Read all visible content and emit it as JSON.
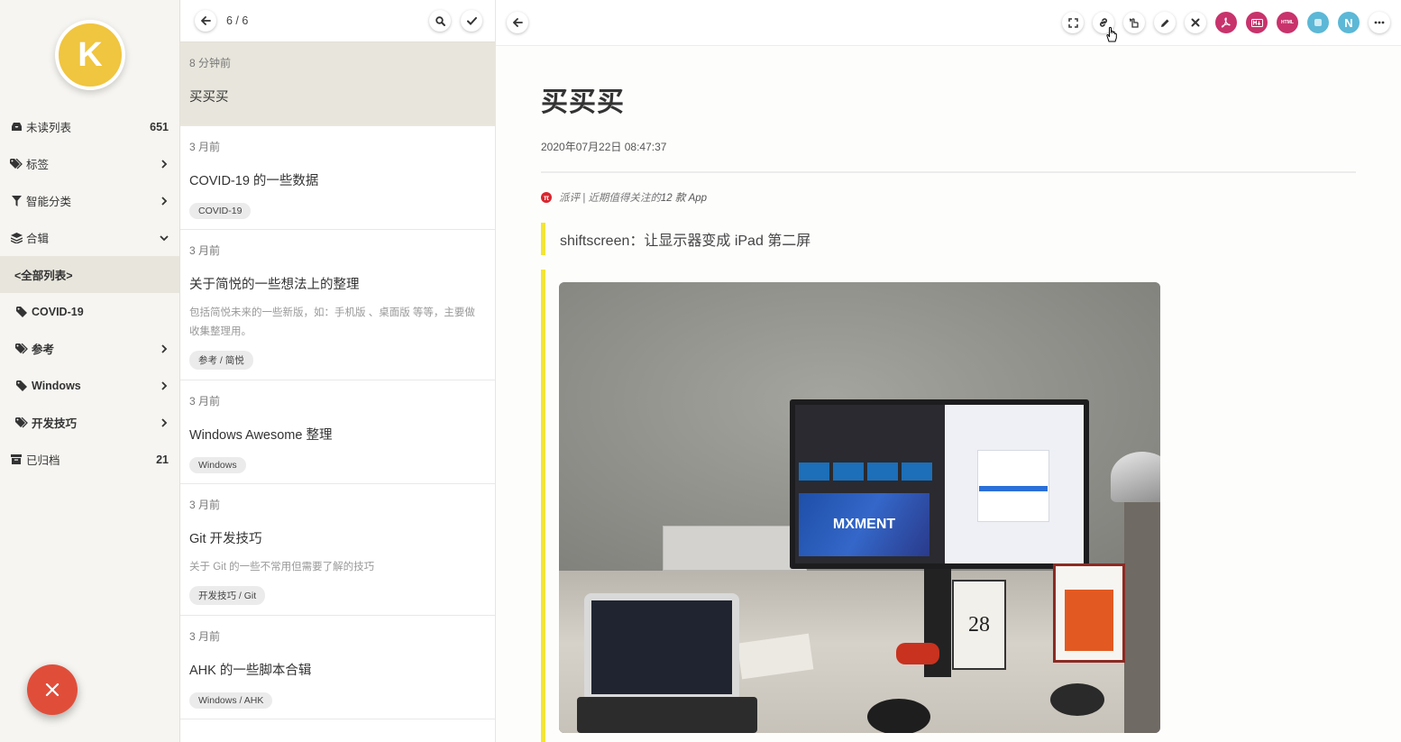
{
  "sidebar": {
    "avatar_letter": "K",
    "items": [
      {
        "label": "未读列表",
        "count": "651",
        "icon": "inbox-icon"
      },
      {
        "label": "标签",
        "icon": "tags-icon"
      },
      {
        "label": "智能分类",
        "icon": "filter-icon"
      },
      {
        "label": "合辑",
        "icon": "layers-icon"
      },
      {
        "label": "<全部列表>"
      },
      {
        "label": "COVID-19",
        "icon": "tag-icon"
      },
      {
        "label": "参考",
        "icon": "tags-icon"
      },
      {
        "label": "Windows",
        "icon": "tag-icon"
      },
      {
        "label": "开发技巧",
        "icon": "tags-icon"
      },
      {
        "label": "已归档",
        "count": "21",
        "icon": "archive-icon"
      }
    ],
    "fab_icon": "close-icon",
    "fab_color": "#e04e3a"
  },
  "list": {
    "pager": "6 / 6",
    "cards": [
      {
        "time": "8 分钟前",
        "title": "买买买",
        "tag": "",
        "desc": ""
      },
      {
        "time": "3 月前",
        "title": "COVID-19 的一些数据",
        "tag": "COVID-19",
        "desc": ""
      },
      {
        "time": "3 月前",
        "title": "关于简悦的一些想法上的整理",
        "desc": "包括简悦未来的一些新版，如：手机版 、桌面版 等等，主要做收集整理用。",
        "tag": "参考 / 简悦"
      },
      {
        "time": "3 月前",
        "title": "Windows Awesome 整理",
        "tag": "Windows",
        "desc": ""
      },
      {
        "time": "3 月前",
        "title": "Git 开发技巧",
        "desc": "关于 Git 的一些不常用但需要了解的技巧",
        "tag": "开发技巧 / Git"
      },
      {
        "time": "3 月前",
        "title": "AHK 的一些脚本合辑",
        "tag": "Windows / AHK",
        "desc": ""
      }
    ]
  },
  "reader": {
    "toolbar": {
      "html_label": "HTML",
      "n_label": "N",
      "colors": {
        "pdf": "#c8336c",
        "md": "#c8336c",
        "html": "#c8336c",
        "cyan": "#5cb8d6",
        "n": "#5cb8d6"
      }
    },
    "article": {
      "title": "买买买",
      "date": "2020年07月22日 08:47:37",
      "source_prefix": "派评 | 近期值得关注的 ",
      "source_suffix": "12 款 App",
      "source_icon_letter": "π",
      "quote": "shiftscreen：让显示器变成 iPad 第二屏",
      "photo": {
        "calendar_day": "28",
        "brand": "MXMENT"
      }
    }
  },
  "colors": {
    "accent_yellow": "#f3e534",
    "avatar": "#f0c53f",
    "selected_bg": "#e8e6dc"
  }
}
